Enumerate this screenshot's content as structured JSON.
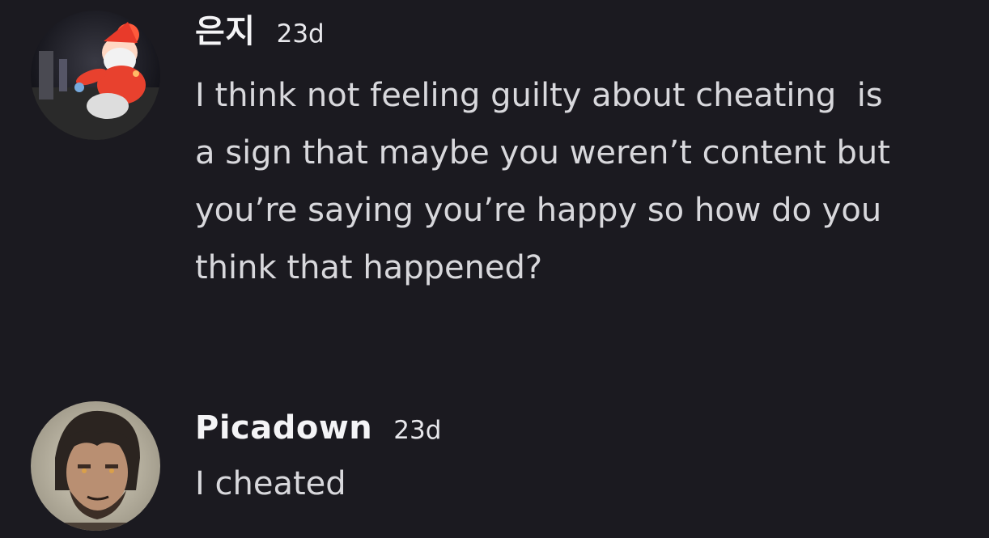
{
  "comments": [
    {
      "username": "은지",
      "timestamp": "23d",
      "avatar": "santa-avatar-icon",
      "text_lines": [
        "I think not feeling guilty about cheating  is",
        "a sign that maybe you weren’t content but",
        "you’re saying you’re happy so how do you",
        "think that happened?"
      ]
    },
    {
      "username": "Picadown",
      "timestamp": "23d",
      "avatar": "bearded-man-avatar-icon",
      "text_lines": [
        "I cheated"
      ]
    }
  ],
  "colors": {
    "background": "#1b1a20",
    "username": "#f4f4f6",
    "text": "#d8d8dc"
  }
}
